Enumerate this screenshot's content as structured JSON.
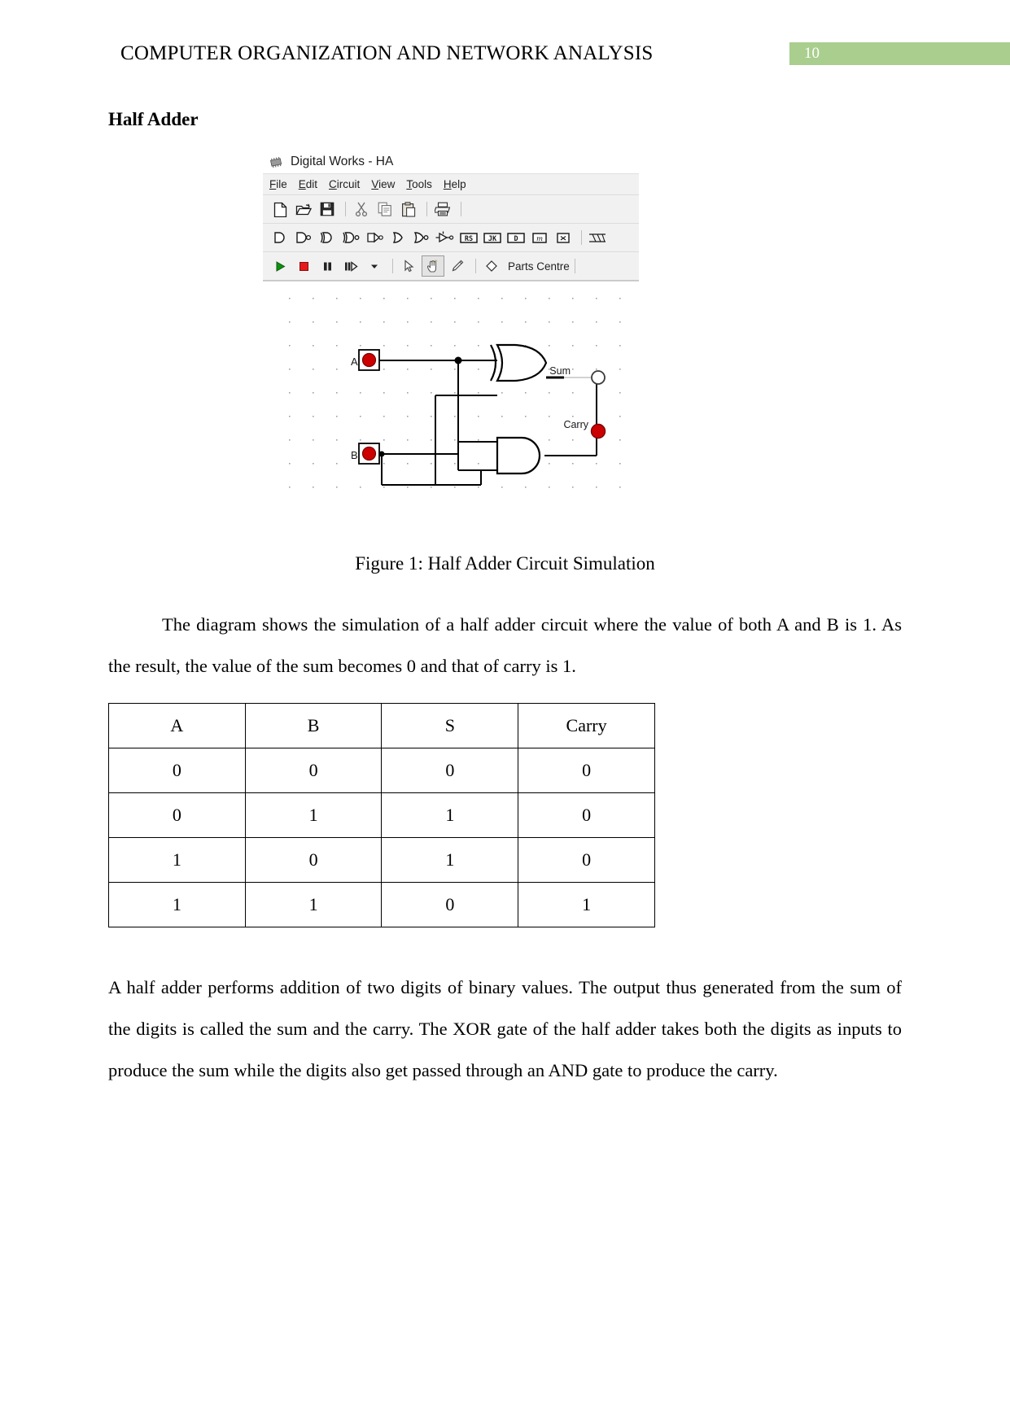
{
  "header": {
    "title": "COMPUTER ORGANIZATION AND NETWORK ANALYSIS",
    "page_number": "10",
    "badge_color": "#A9CE8E"
  },
  "section": {
    "heading": "Half Adder"
  },
  "app_window": {
    "title": "Digital Works - HA",
    "icon": "chip-icon",
    "menu": [
      {
        "label": "File",
        "mnemonic": "F",
        "rest": "ile"
      },
      {
        "label": "Edit",
        "mnemonic": "E",
        "rest": "dit"
      },
      {
        "label": "Circuit",
        "mnemonic": "C",
        "rest": "ircuit"
      },
      {
        "label": "View",
        "mnemonic": "V",
        "rest": "iew"
      },
      {
        "label": "Tools",
        "mnemonic": "T",
        "rest": "ools"
      },
      {
        "label": "Help",
        "mnemonic": "H",
        "rest": "elp"
      }
    ],
    "file_toolbar": [
      {
        "name": "new-document-icon",
        "title": "New"
      },
      {
        "name": "open-folder-icon",
        "title": "Open"
      },
      {
        "name": "save-disk-icon",
        "title": "Save"
      },
      {
        "name": "separator",
        "title": ""
      },
      {
        "name": "cut-scissors-icon",
        "title": "Cut"
      },
      {
        "name": "copy-icon",
        "title": "Copy"
      },
      {
        "name": "paste-clipboard-icon",
        "title": "Paste"
      },
      {
        "name": "separator",
        "title": ""
      },
      {
        "name": "print-icon",
        "title": "Print"
      },
      {
        "name": "separator",
        "title": ""
      }
    ],
    "gate_toolbar": [
      {
        "name": "and-gate-icon",
        "title": "AND"
      },
      {
        "name": "nand-gate-icon",
        "title": "NAND"
      },
      {
        "name": "xor-gate-icon",
        "title": "XOR"
      },
      {
        "name": "xnor-gate-icon",
        "title": "XNOR"
      },
      {
        "name": "not-gate-icon",
        "title": "NOT"
      },
      {
        "name": "or-gate-icon",
        "title": "OR"
      },
      {
        "name": "nor-gate-icon",
        "title": "NOR"
      },
      {
        "name": "tristate-buffer-icon",
        "title": "Tri-state"
      },
      {
        "name": "rs-flipflop-icon",
        "title": "RS"
      },
      {
        "name": "jk-flipflop-icon",
        "title": "JK"
      },
      {
        "name": "d-flipflop-icon",
        "title": "D"
      },
      {
        "name": "m-flipflop-icon",
        "title": "m"
      },
      {
        "name": "cross-icon",
        "title": "x"
      },
      {
        "name": "separator",
        "title": ""
      },
      {
        "name": "bus-icon",
        "title": "Bus"
      }
    ],
    "sim_toolbar": {
      "buttons": [
        {
          "name": "run-play-icon",
          "title": "Run",
          "color": "#118811"
        },
        {
          "name": "stop-icon",
          "title": "Stop",
          "color": "#e01b1b"
        },
        {
          "name": "pause-icon",
          "title": "Pause",
          "color": "#222222"
        },
        {
          "name": "step-icon",
          "title": "Step",
          "color": "#222222"
        },
        {
          "name": "speed-dropdown-icon",
          "title": "Speed",
          "color": "#222222"
        }
      ],
      "tools": [
        {
          "name": "pointer-cursor-icon",
          "title": "Select",
          "pressed": false
        },
        {
          "name": "hand-tool-icon",
          "title": "Hand",
          "pressed": true
        },
        {
          "name": "pencil-tool-icon",
          "title": "Draw",
          "pressed": false
        }
      ],
      "parts_centre_label": "Parts Centre",
      "parts_centre_icon": "diamond-icon"
    },
    "circuit": {
      "input_a_label": "A",
      "input_b_label": "B",
      "input_a_state": "on",
      "input_b_state": "on",
      "output_sum_label": "Sum",
      "output_sum_state": "off",
      "output_carry_label": "Carry",
      "output_carry_state": "on",
      "led_on_color": "#cc0000",
      "xor_gate_label": "XOR",
      "and_gate_label": "AND"
    }
  },
  "figure": {
    "caption": "Figure 1: Half Adder Circuit Simulation"
  },
  "paragraphs": {
    "p1": "The diagram shows the simulation of a half adder circuit where the value of both A and B is 1. As the result, the value of the sum becomes 0 and that of carry is 1.",
    "p2": "A half adder performs addition of two digits of binary values. The output thus generated from the sum of the digits is called the sum and the carry. The XOR gate of the half adder takes both the digits as inputs to produce the sum while the digits also get passed through an AND gate to produce the carry."
  },
  "truth_table": {
    "headers": [
      "A",
      "B",
      "S",
      "Carry"
    ],
    "rows": [
      [
        "0",
        "0",
        "0",
        "0"
      ],
      [
        "0",
        "1",
        "1",
        "0"
      ],
      [
        "1",
        "0",
        "1",
        "0"
      ],
      [
        "1",
        "1",
        "0",
        "1"
      ]
    ]
  }
}
